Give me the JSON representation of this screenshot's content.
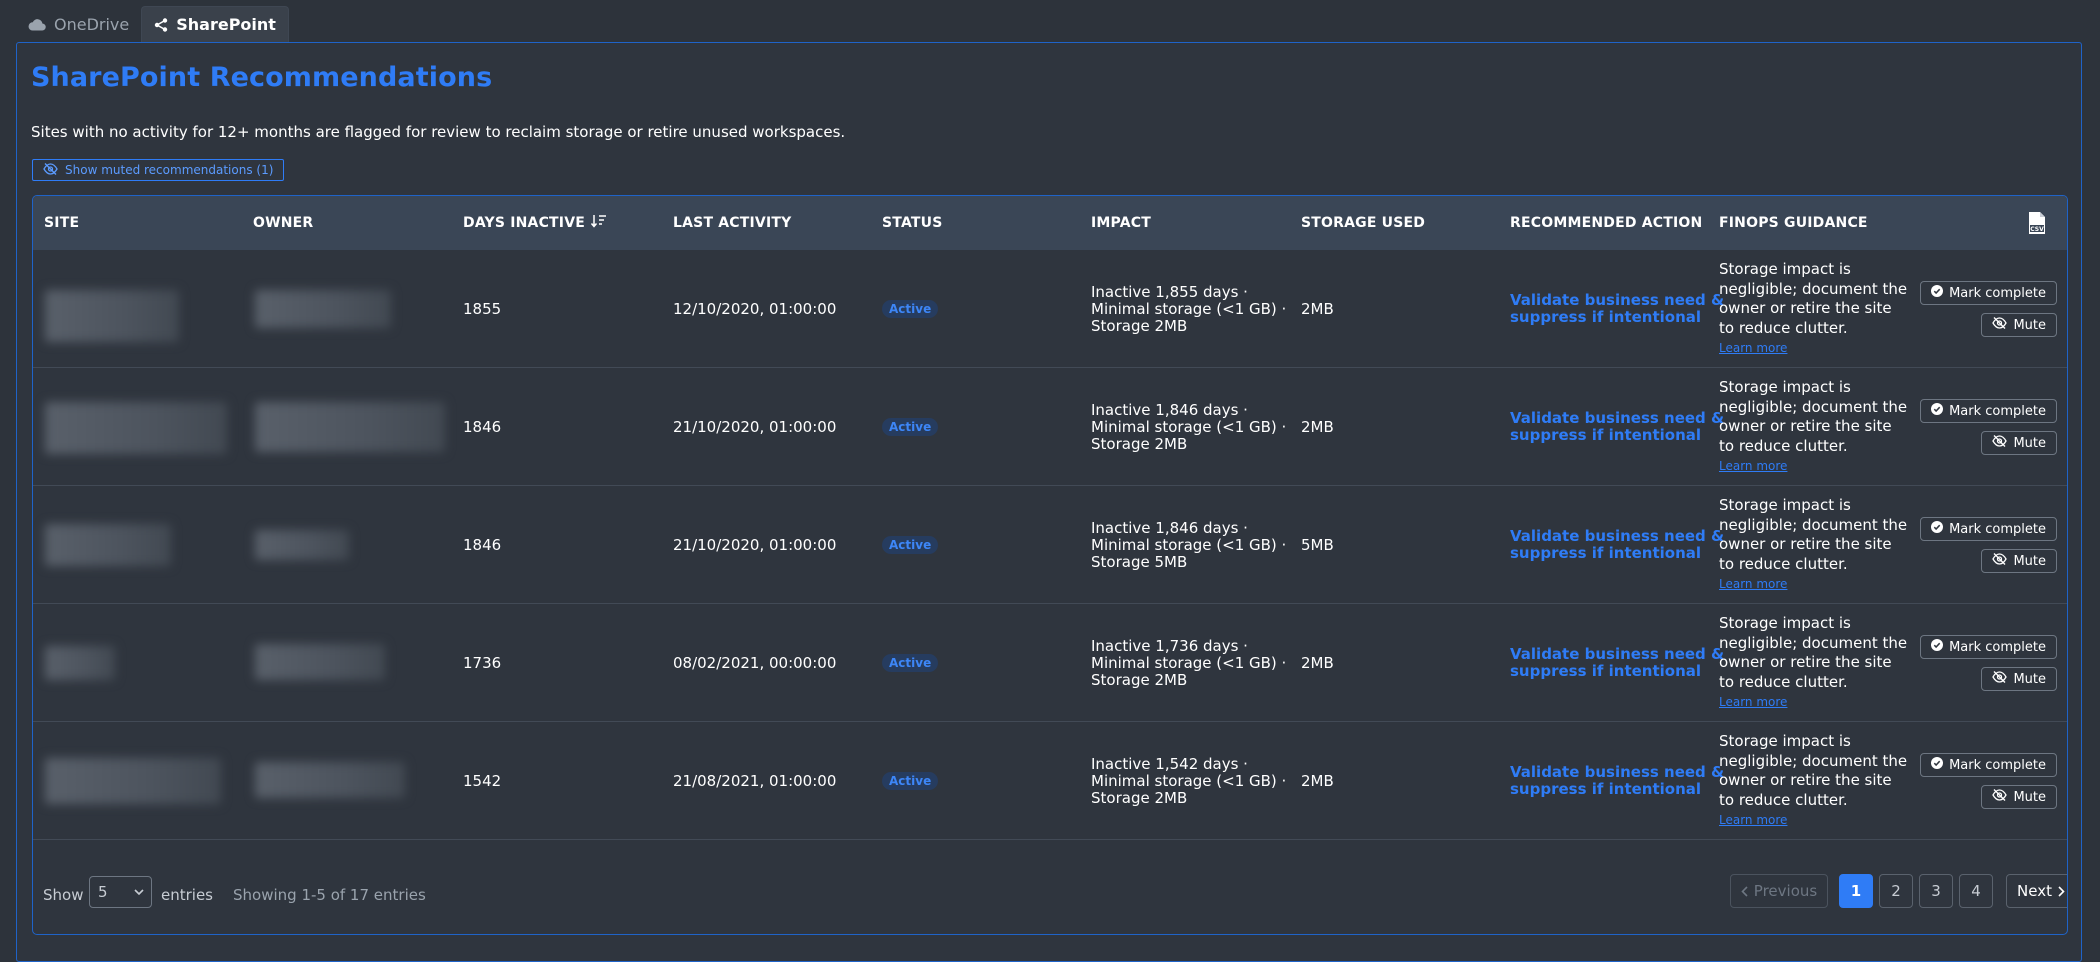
{
  "tabs": [
    {
      "label": "OneDrive",
      "icon": "cloud-icon",
      "active": false
    },
    {
      "label": "SharePoint",
      "icon": "share-icon",
      "active": true
    }
  ],
  "page": {
    "title": "SharePoint Recommendations",
    "description": "Sites with no activity for 12+ months are flagged for review to reclaim storage or retire unused workspaces.",
    "muted_button_label": "Show muted recommendations (1)"
  },
  "table": {
    "columns": [
      "SITE",
      "OWNER",
      "DAYS INACTIVE",
      "LAST ACTIVITY",
      "STATUS",
      "IMPACT",
      "STORAGE USED",
      "RECOMMENDED ACTION",
      "FINOPS GUIDANCE"
    ],
    "rows": [
      {
        "days_inactive": "1855",
        "last_activity": "12/10/2020, 01:00:00",
        "status": "Active",
        "impact": [
          "Inactive 1,855 days ·",
          "Minimal storage (<1 GB) ·",
          "Storage 2MB"
        ],
        "storage_used": "2MB",
        "action": [
          "Validate business need &",
          "suppress if intentional"
        ],
        "guidance": "Storage impact is negligible; document the owner or retire the site to reduce clutter.",
        "learn_more": "Learn more",
        "mark_complete": "Mark complete",
        "mute": "Mute"
      },
      {
        "days_inactive": "1846",
        "last_activity": "21/10/2020, 01:00:00",
        "status": "Active",
        "impact": [
          "Inactive 1,846 days ·",
          "Minimal storage (<1 GB) ·",
          "Storage 2MB"
        ],
        "storage_used": "2MB",
        "action": [
          "Validate business need &",
          "suppress if intentional"
        ],
        "guidance": "Storage impact is negligible; document the owner or retire the site to reduce clutter.",
        "learn_more": "Learn more",
        "mark_complete": "Mark complete",
        "mute": "Mute"
      },
      {
        "days_inactive": "1846",
        "last_activity": "21/10/2020, 01:00:00",
        "status": "Active",
        "impact": [
          "Inactive 1,846 days ·",
          "Minimal storage (<1 GB) ·",
          "Storage 5MB"
        ],
        "storage_used": "5MB",
        "action": [
          "Validate business need &",
          "suppress if intentional"
        ],
        "guidance": "Storage impact is negligible; document the owner or retire the site to reduce clutter.",
        "learn_more": "Learn more",
        "mark_complete": "Mark complete",
        "mute": "Mute"
      },
      {
        "days_inactive": "1736",
        "last_activity": "08/02/2021, 00:00:00",
        "status": "Active",
        "impact": [
          "Inactive 1,736 days ·",
          "Minimal storage (<1 GB) ·",
          "Storage 2MB"
        ],
        "storage_used": "2MB",
        "action": [
          "Validate business need &",
          "suppress if intentional"
        ],
        "guidance": "Storage impact is negligible; document the owner or retire the site to reduce clutter.",
        "learn_more": "Learn more",
        "mark_complete": "Mark complete",
        "mute": "Mute"
      },
      {
        "days_inactive": "1542",
        "last_activity": "21/08/2021, 01:00:00",
        "status": "Active",
        "impact": [
          "Inactive 1,542 days ·",
          "Minimal storage (<1 GB) ·",
          "Storage 2MB"
        ],
        "storage_used": "2MB",
        "action": [
          "Validate business need &",
          "suppress if intentional"
        ],
        "guidance": "Storage impact is negligible; document the owner or retire the site to reduce clutter.",
        "learn_more": "Learn more",
        "mark_complete": "Mark complete",
        "mute": "Mute"
      }
    ]
  },
  "footer": {
    "show_label": "Show",
    "entries_value": "5",
    "entries_label": "entries",
    "showing_text": "Showing 1-5 of 17 entries",
    "previous_label": "Previous",
    "next_label": "Next",
    "pages": [
      "1",
      "2",
      "3",
      "4"
    ],
    "current_page": "1"
  },
  "colors": {
    "accent": "#2f7cf6",
    "background": "#2d333b",
    "header_bg": "#3a4656"
  }
}
